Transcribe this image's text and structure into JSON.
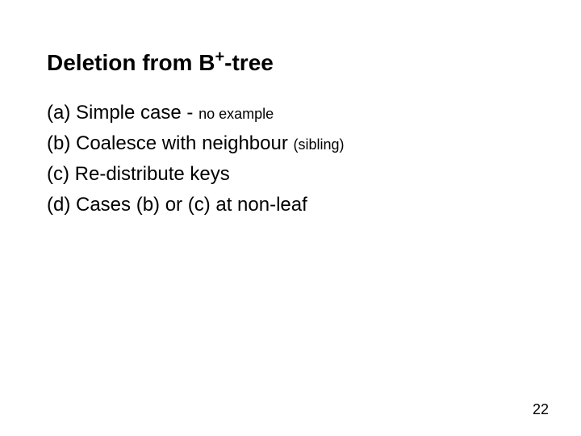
{
  "title": {
    "pre": "Deletion from B",
    "sup": "+",
    "post": "-tree"
  },
  "items": {
    "a": {
      "label": "(a) Simple case - ",
      "small": "no example"
    },
    "b": {
      "label": "(b) Coalesce with neighbour ",
      "small": "(sibling)"
    },
    "c": {
      "label": "(c) Re-distribute keys"
    },
    "d": {
      "label": "(d) Cases (b) or (c) at non-leaf"
    }
  },
  "page_number": "22"
}
